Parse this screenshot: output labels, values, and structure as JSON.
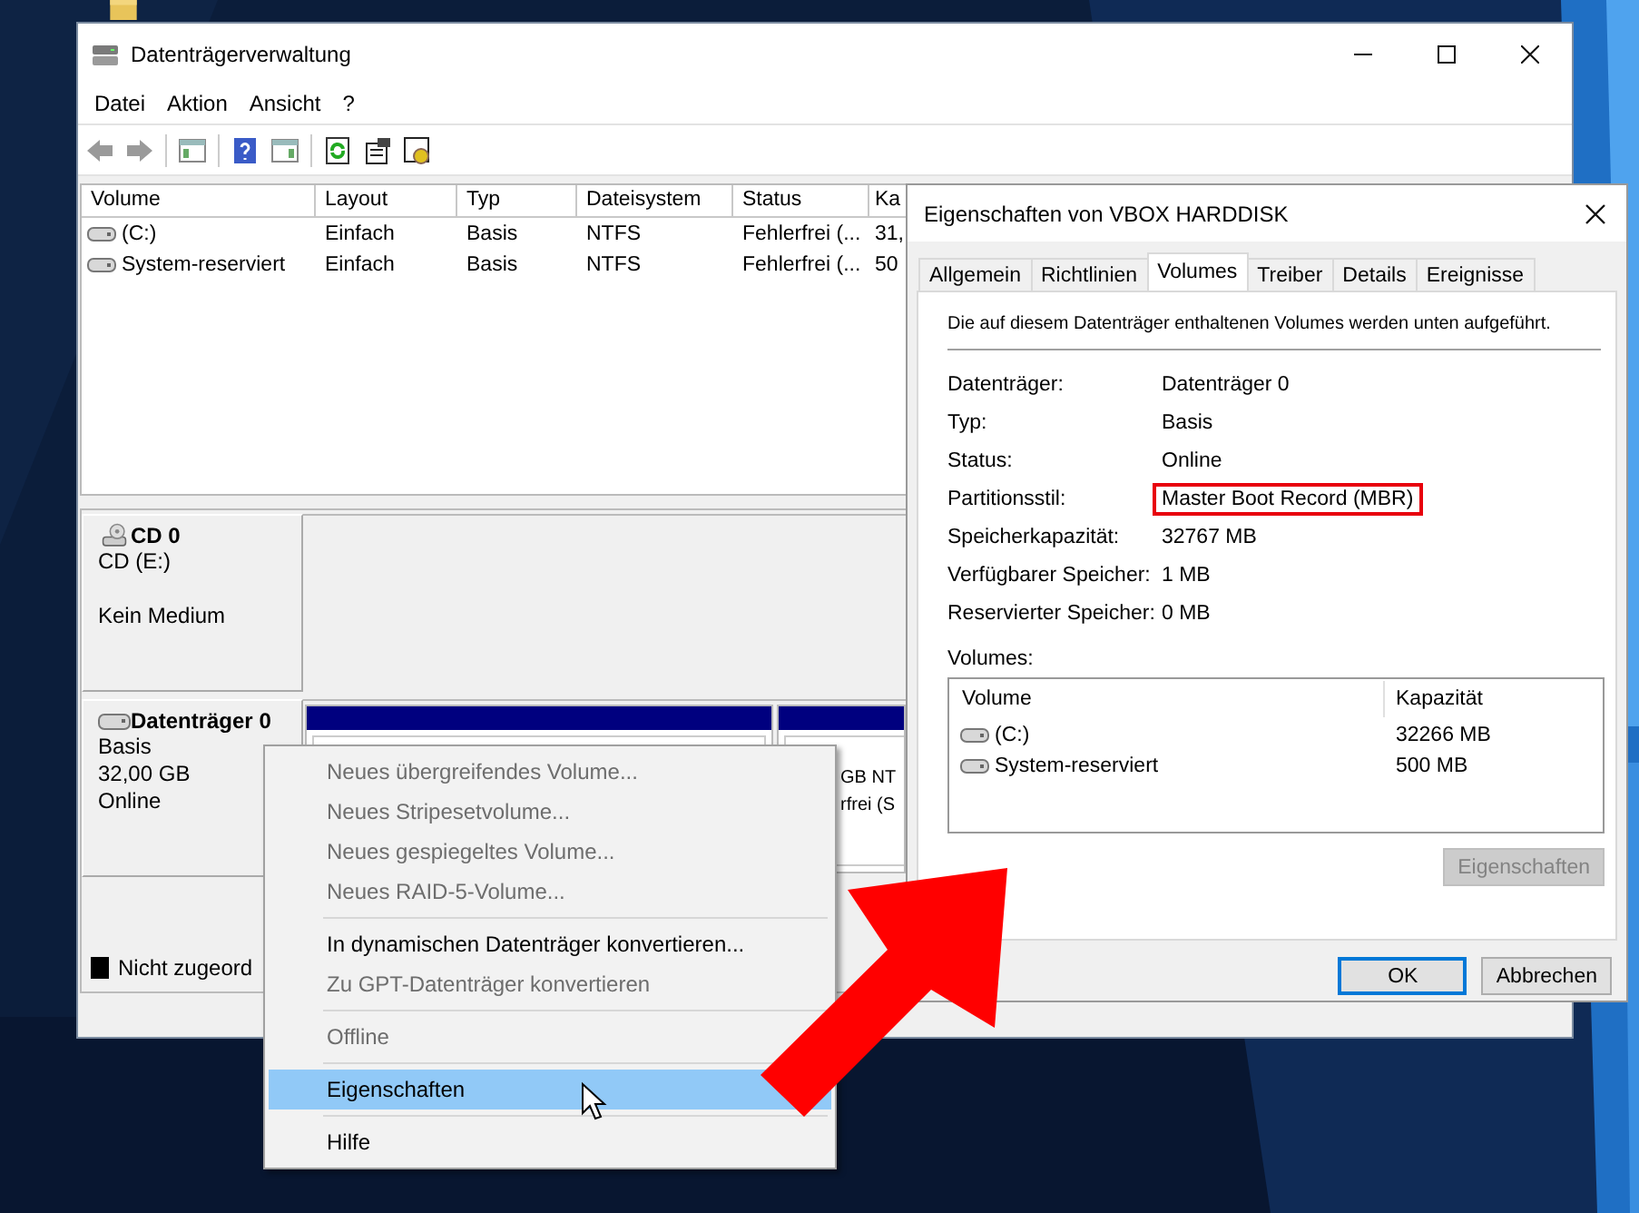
{
  "window": {
    "title": "Datenträgerverwaltung",
    "menu": [
      "Datei",
      "Aktion",
      "Ansicht",
      "?"
    ]
  },
  "volume_table": {
    "columns": [
      "Volume",
      "Layout",
      "Typ",
      "Dateisystem",
      "Status",
      "Ka"
    ],
    "rows": [
      {
        "cells": [
          "(C:)",
          "Einfach",
          "Basis",
          "NTFS",
          "Fehlerfrei (...",
          "31,"
        ]
      },
      {
        "cells": [
          "System-reserviert",
          "Einfach",
          "Basis",
          "NTFS",
          "Fehlerfrei (...",
          "50"
        ]
      }
    ]
  },
  "disks": [
    {
      "kind": "cd",
      "name": "CD 0",
      "lines": [
        "CD (E:)",
        "Kein Medium"
      ]
    },
    {
      "kind": "disk",
      "name": "Datenträger 0",
      "lines": [
        "Basis",
        "32,00 GB",
        "Online"
      ],
      "partitions": [
        {
          "kind": "partition"
        },
        {
          "kind": "partition",
          "lines": [
            "GB NT",
            "rfrei (S"
          ]
        }
      ]
    }
  ],
  "legend": [
    {
      "label": "Nicht zugeord",
      "color": "#000000"
    }
  ],
  "context_menu": [
    {
      "kind": "item",
      "label": "Neues übergreifendes Volume...",
      "disabled": true,
      "selected": false
    },
    {
      "kind": "item",
      "label": "Neues Stripesetvolume...",
      "disabled": true,
      "selected": false
    },
    {
      "kind": "item",
      "label": "Neues gespiegeltes Volume...",
      "disabled": true,
      "selected": false
    },
    {
      "kind": "item",
      "label": "Neues RAID-5-Volume...",
      "disabled": true,
      "selected": false
    },
    {
      "kind": "separator"
    },
    {
      "kind": "item",
      "label": "In dynamischen Datenträger konvertieren...",
      "disabled": false,
      "selected": false
    },
    {
      "kind": "item",
      "label": "Zu GPT-Datenträger konvertieren",
      "disabled": true,
      "selected": false
    },
    {
      "kind": "separator"
    },
    {
      "kind": "item",
      "label": "Offline",
      "disabled": true,
      "selected": false
    },
    {
      "kind": "separator"
    },
    {
      "kind": "item",
      "label": "Eigenschaften",
      "disabled": false,
      "selected": true
    },
    {
      "kind": "separator"
    },
    {
      "kind": "item",
      "label": "Hilfe",
      "disabled": false,
      "selected": false
    }
  ],
  "dialog": {
    "title": "Eigenschaften von VBOX HARDDISK",
    "tabs": [
      {
        "label": "Allgemein",
        "selected": false
      },
      {
        "label": "Richtlinien",
        "selected": false
      },
      {
        "label": "Volumes",
        "selected": true
      },
      {
        "label": "Treiber",
        "selected": false
      },
      {
        "label": "Details",
        "selected": false
      },
      {
        "label": "Ereignisse",
        "selected": false
      }
    ],
    "description": "Die auf diesem Datenträger enthaltenen Volumes werden unten aufgeführt.",
    "properties": [
      {
        "label": "Datenträger:",
        "value": "Datenträger 0",
        "highlighted": false
      },
      {
        "label": "Typ:",
        "value": "Basis",
        "highlighted": false
      },
      {
        "label": "Status:",
        "value": "Online",
        "highlighted": false
      },
      {
        "label": "Partitionsstil:",
        "value": "Master Boot Record (MBR)",
        "highlighted": true
      },
      {
        "label": "Speicherkapazität:",
        "value": "32767 MB",
        "highlighted": false
      },
      {
        "label": "Verfügbarer Speicher:",
        "value": "1 MB",
        "highlighted": false
      },
      {
        "label": "Reservierter Speicher:",
        "value": "0 MB",
        "highlighted": false
      }
    ],
    "volumes_label": "Volumes:",
    "volumes_table": {
      "columns": [
        "Volume",
        "Kapazität"
      ],
      "rows": [
        {
          "cells": [
            "(C:)",
            "32266 MB"
          ]
        },
        {
          "cells": [
            "System-reserviert",
            "500 MB"
          ]
        }
      ]
    },
    "properties_button": {
      "label": "Eigenschaften",
      "disabled": true
    },
    "buttons": [
      {
        "label": "OK",
        "default": true
      },
      {
        "label": "Abbrechen",
        "default": false
      }
    ]
  }
}
